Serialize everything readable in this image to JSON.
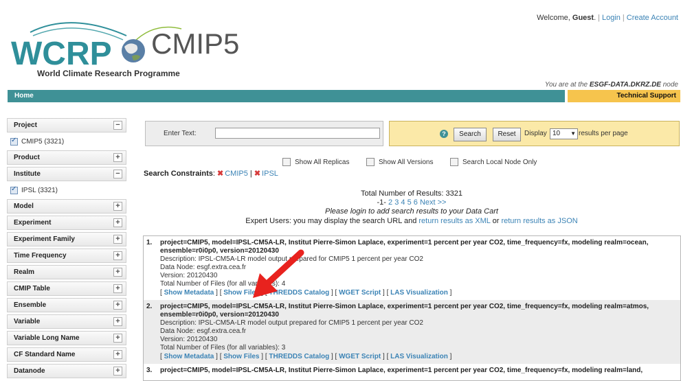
{
  "header": {
    "welcome_prefix": "Welcome,",
    "user": "Guest",
    "login": "Login",
    "create_account": "Create Account",
    "logo_text": "WCRP",
    "logo_product": "CMIP5",
    "logo_subtitle": "World Climate Research Programme",
    "node_prefix": "You are at the",
    "node_name": "ESGF-DATA.DKRZ.DE",
    "node_suffix": "node"
  },
  "nav": {
    "home": "Home",
    "tech_support": "Technical Support"
  },
  "sidebar": {
    "facets": [
      {
        "label": "Project",
        "expanded": true,
        "values": [
          {
            "label": "CMIP5 (3321)",
            "checked": true
          }
        ]
      },
      {
        "label": "Product",
        "expanded": false
      },
      {
        "label": "Institute",
        "expanded": true,
        "values": [
          {
            "label": "IPSL (3321)",
            "checked": true
          }
        ]
      },
      {
        "label": "Model",
        "expanded": false
      },
      {
        "label": "Experiment",
        "expanded": false
      },
      {
        "label": "Experiment Family",
        "expanded": false
      },
      {
        "label": "Time Frequency",
        "expanded": false
      },
      {
        "label": "Realm",
        "expanded": false
      },
      {
        "label": "CMIP Table",
        "expanded": false
      },
      {
        "label": "Ensemble",
        "expanded": false
      },
      {
        "label": "Variable",
        "expanded": false
      },
      {
        "label": "Variable Long Name",
        "expanded": false
      },
      {
        "label": "CF Standard Name",
        "expanded": false
      },
      {
        "label": "Datanode",
        "expanded": false
      }
    ]
  },
  "search": {
    "enter_text_label": "Enter Text:",
    "query": "",
    "help": "?",
    "search_button": "Search",
    "reset_button": "Reset",
    "display_label": "Display",
    "per_page": "10",
    "per_page_suffix": "results per page",
    "show_all_replicas": "Show All Replicas",
    "show_all_versions": "Show All Versions",
    "search_local_only": "Search Local Node Only",
    "constraints_label": "Search Constraints",
    "constraint_1": "CMIP5",
    "constraint_2": "IPSL"
  },
  "summary": {
    "total": "Total Number of Results: 3321",
    "current_page": "-1-",
    "pages": [
      "2",
      "3",
      "4",
      "5",
      "6"
    ],
    "next": "Next >>",
    "login_note": "Please login to add search results to your Data Cart",
    "expert_prefix": "Expert Users: you may display the search URL and",
    "xml_link": "return results as XML",
    "or": "or",
    "json_link": "return results as JSON"
  },
  "results": [
    {
      "num": "1.",
      "title": "project=CMIP5, model=IPSL-CM5A-LR, Institut Pierre-Simon Laplace, experiment=1 percent per year CO2, time_frequency=fx, modeling realm=ocean, ensemble=r0i0p0, version=20120430",
      "description": "Description: IPSL-CM5A-LR model output prepared for CMIP5 1 percent per year CO2",
      "data_node": "Data Node: esgf.extra.cea.fr",
      "version": "Version: 20120430",
      "files": "Total Number of Files (for all variables): 4",
      "links": [
        "Show Metadata",
        "Show Files",
        "THREDDS Catalog",
        "WGET Script",
        "LAS Visualization"
      ]
    },
    {
      "num": "2.",
      "title": "project=CMIP5, model=IPSL-CM5A-LR, Institut Pierre-Simon Laplace, experiment=1 percent per year CO2, time_frequency=fx, modeling realm=atmos, ensemble=r0i0p0, version=20120430",
      "description": "Description: IPSL-CM5A-LR model output prepared for CMIP5 1 percent per year CO2",
      "data_node": "Data Node: esgf.extra.cea.fr",
      "version": "Version: 20120430",
      "files": "Total Number of Files (for all variables): 3",
      "links": [
        "Show Metadata",
        "Show Files",
        "THREDDS Catalog",
        "WGET Script",
        "LAS Visualization"
      ]
    },
    {
      "num": "3.",
      "title": "project=CMIP5, model=IPSL-CM5A-LR, Institut Pierre-Simon Laplace, experiment=1 percent per year CO2, time_frequency=fx, modeling realm=land,"
    }
  ],
  "colors": {
    "nav_teal": "#3f9196",
    "support_yellow": "#f6c44d",
    "link_blue": "#3b83b5",
    "remove_red": "#d63a3a"
  }
}
